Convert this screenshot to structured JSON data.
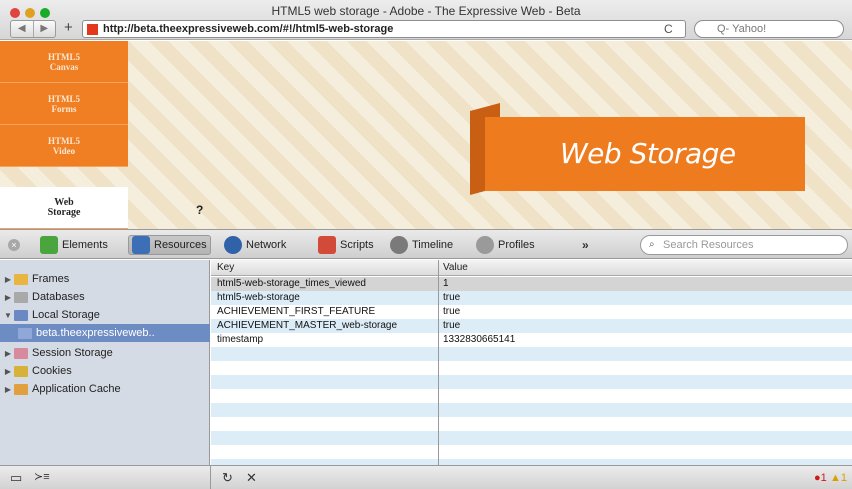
{
  "window": {
    "title": "HTML5 web storage - Adobe - The Expressive Web - Beta",
    "back": "◀",
    "forward": "▶",
    "add_tab": "+",
    "url": "http://beta.theexpressiveweb.com/#!/html5-web-storage",
    "reload": "C",
    "search_placeholder": "Q- Yahoo!"
  },
  "page": {
    "nav": [
      {
        "label": "HTML5 Canvas"
      },
      {
        "label": "HTML5 Forms"
      },
      {
        "label": "HTML5 Video"
      },
      {
        "label": "Web Storage"
      }
    ],
    "question_mark": "?",
    "banner_title": "Web Storage"
  },
  "devtools": {
    "tools": [
      {
        "label": "Elements",
        "icon": "elements-icon",
        "color": "#4aa53f"
      },
      {
        "label": "Resources",
        "icon": "resources-icon",
        "color": "#3d6fb6"
      },
      {
        "label": "Network",
        "icon": "network-icon",
        "color": "#2f62a8"
      },
      {
        "label": "Scripts",
        "icon": "scripts-icon",
        "color": "#d24a38"
      },
      {
        "label": "Timeline",
        "icon": "timeline-icon",
        "color": "#7a7a7a"
      },
      {
        "label": "Profiles",
        "icon": "profiles-icon",
        "color": "#7a7a7a"
      }
    ],
    "overflow": "»",
    "search_placeholder": "Search Resources",
    "sidebar": [
      {
        "label": "Frames",
        "arrow": "▶",
        "icon": "folder-icon",
        "color": "#e8b540"
      },
      {
        "label": "Databases",
        "arrow": "▶",
        "icon": "database-icon",
        "color": "#a9a9a9"
      },
      {
        "label": "Local Storage",
        "arrow": "▼",
        "icon": "local-storage-icon",
        "color": "#6a89c2"
      },
      {
        "label": "beta.theexpressiveweb..",
        "arrow": "",
        "icon": "storage-item-icon",
        "color": "#8fa8d8"
      },
      {
        "label": "Session Storage",
        "arrow": "▶",
        "icon": "session-storage-icon",
        "color": "#d88a9c"
      },
      {
        "label": "Cookies",
        "arrow": "▶",
        "icon": "cookies-icon",
        "color": "#d6b23a"
      },
      {
        "label": "Application Cache",
        "arrow": "▶",
        "icon": "app-cache-icon",
        "color": "#e0a040"
      }
    ],
    "table": {
      "headers": {
        "key": "Key",
        "value": "Value"
      },
      "rows": [
        {
          "key": "html5-web-storage_times_viewed",
          "value": "1"
        },
        {
          "key": "html5-web-storage",
          "value": "true"
        },
        {
          "key": "ACHIEVEMENT_FIRST_FEATURE",
          "value": "true"
        },
        {
          "key": "ACHIEVEMENT_MASTER_web-storage",
          "value": "true"
        },
        {
          "key": "timestamp",
          "value": "1332830665141"
        }
      ]
    },
    "status": {
      "dock_icon": "▭",
      "console_icon": "≻≡",
      "refresh_icon": "↻",
      "delete_icon": "✕",
      "errors": "1",
      "warnings": "1"
    }
  }
}
